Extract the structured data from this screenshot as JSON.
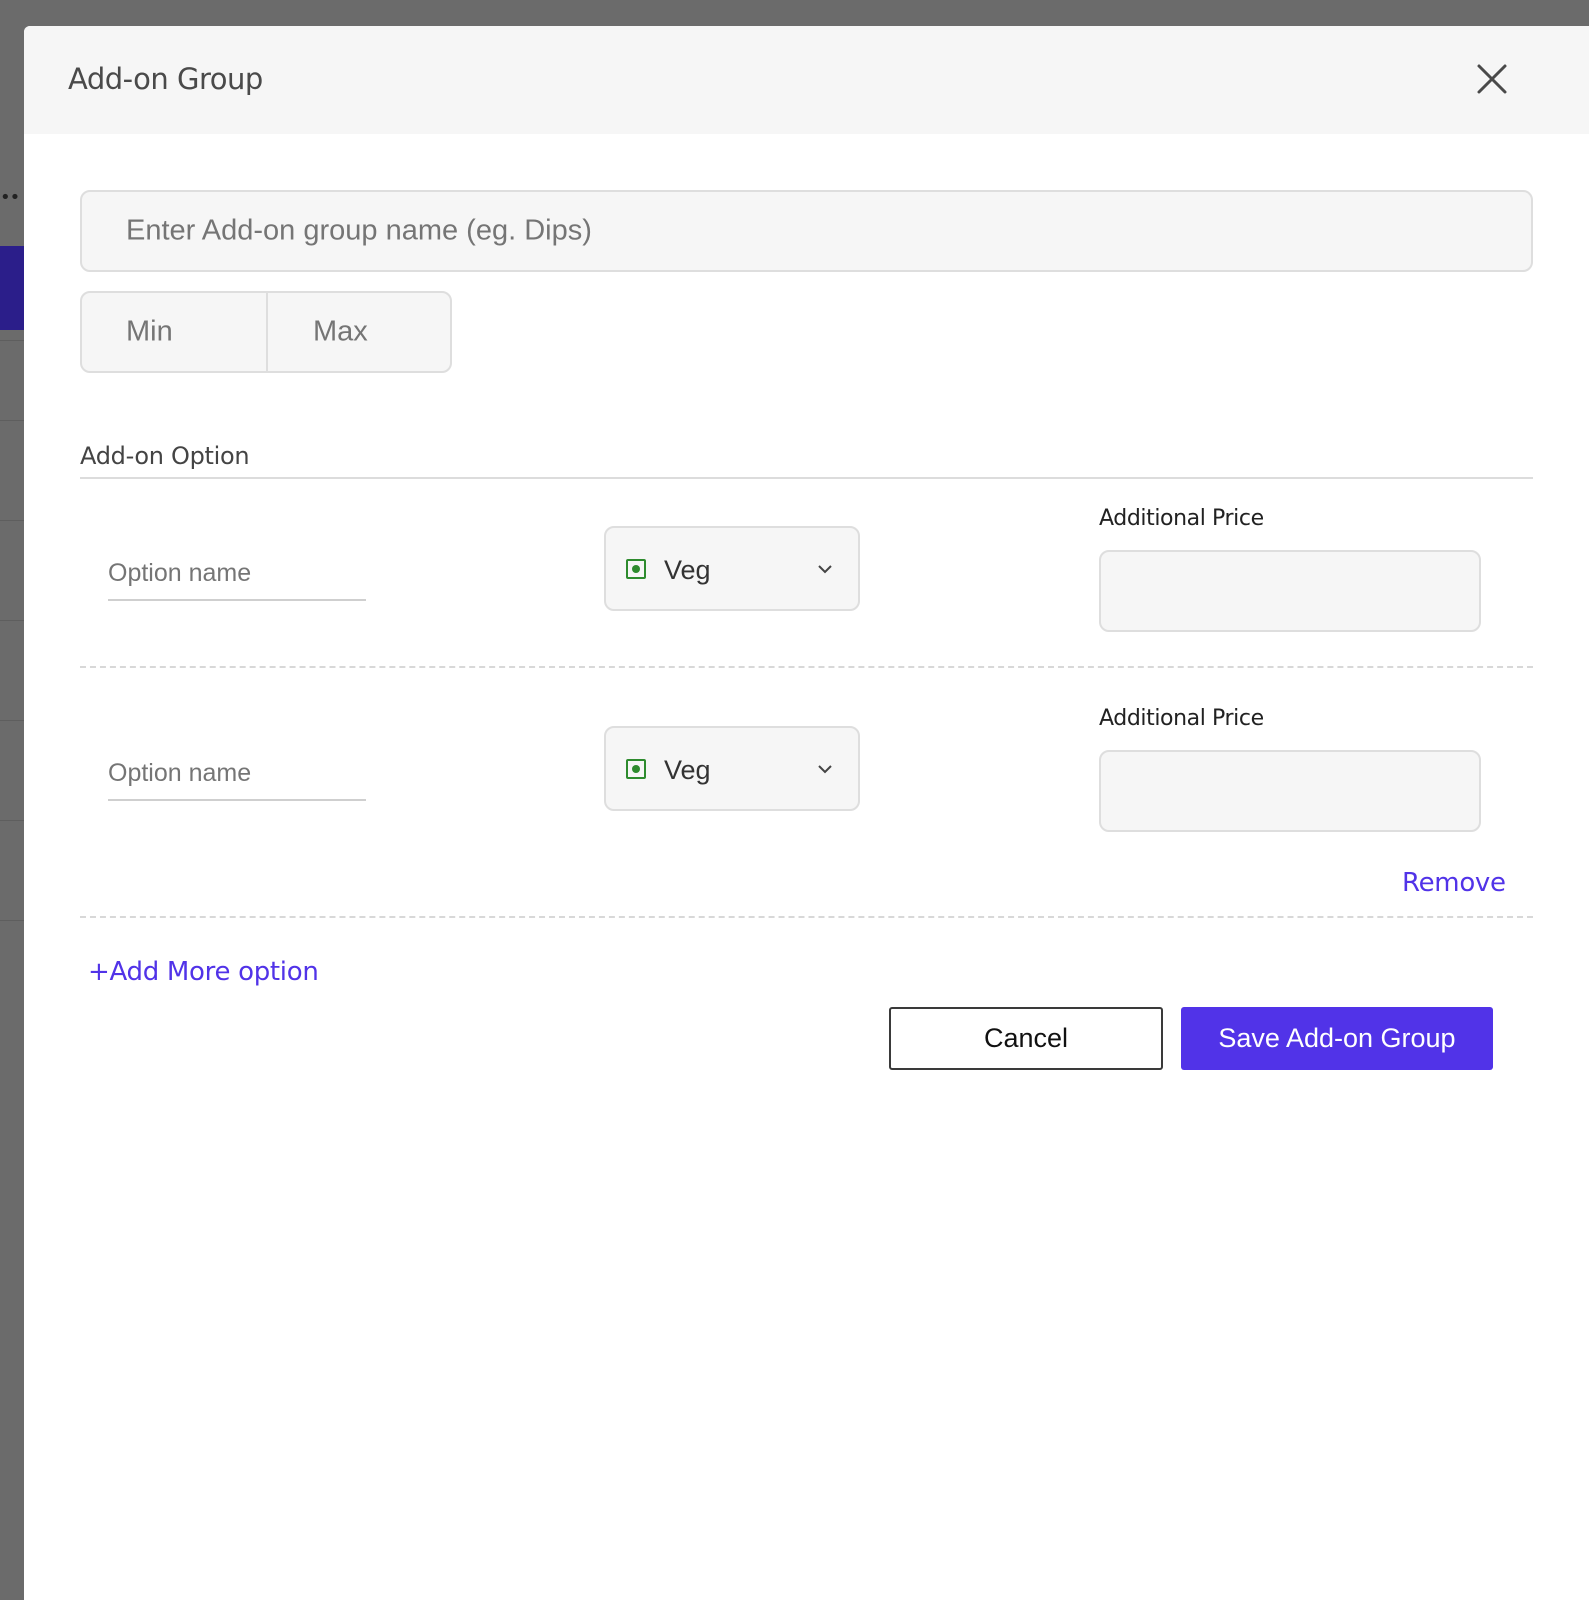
{
  "modal": {
    "title": "Add-on Group",
    "close_icon": "close-icon"
  },
  "group": {
    "name_placeholder": "Enter Add-on group name (eg. Dips)",
    "min_placeholder": "Min",
    "max_placeholder": "Max"
  },
  "addon_section": {
    "label": "Add-on Option"
  },
  "options": [
    {
      "name_placeholder": "Option name",
      "type": "Veg",
      "price_label": "Additional Price",
      "price_value": ""
    },
    {
      "name_placeholder": "Option name",
      "type": "Veg",
      "price_label": "Additional Price",
      "price_value": "",
      "remove_label": "Remove"
    }
  ],
  "actions": {
    "add_more_label": "+Add More option",
    "cancel_label": "Cancel",
    "save_label": "Save Add-on Group"
  },
  "colors": {
    "accent": "#5133e8",
    "veg_green": "#2e8b2e",
    "field_bg": "#f6f6f6",
    "overlay": "#6b6b6b"
  }
}
